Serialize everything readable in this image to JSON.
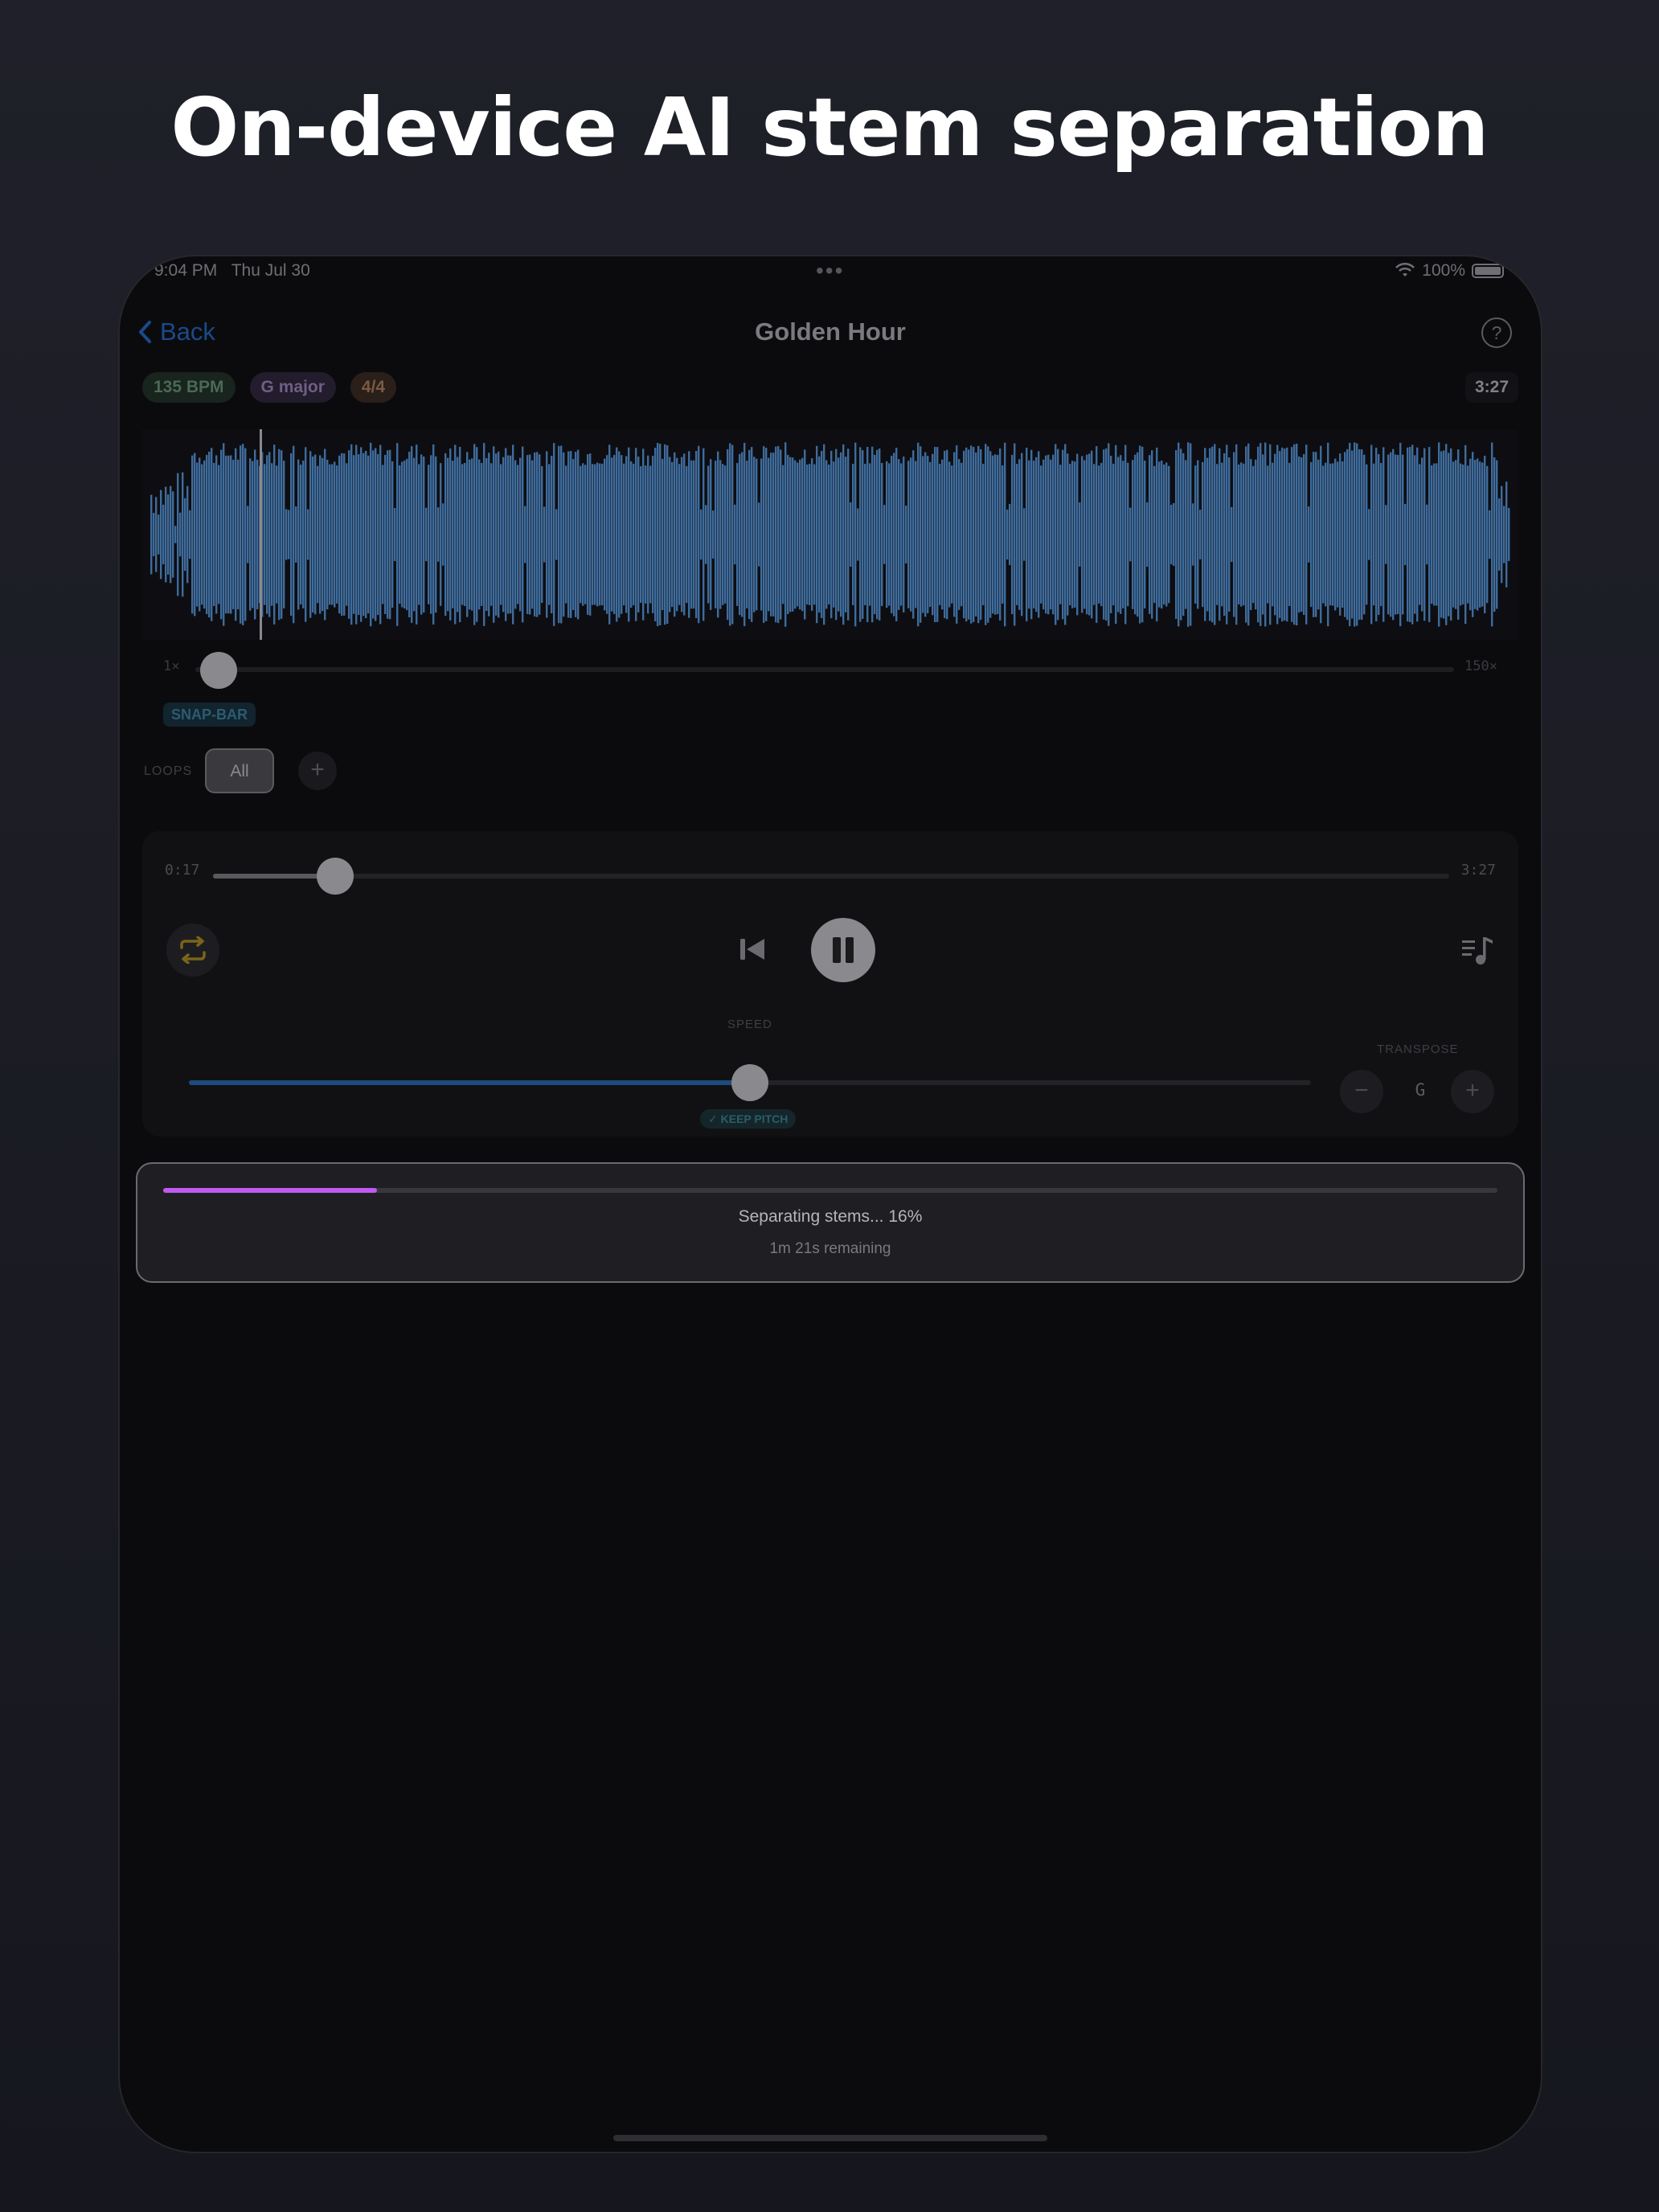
{
  "headline": "On-device AI stem separation",
  "status_bar": {
    "time": "9:04 PM",
    "date": "Thu Jul 30",
    "battery": "100%"
  },
  "nav": {
    "back_label": "Back",
    "title": "Golden Hour",
    "help_icon": "?"
  },
  "track_info": {
    "bpm": "135 BPM",
    "key": "G major",
    "time_signature": "4/4",
    "duration": "3:27"
  },
  "zoom": {
    "min_label": "1×",
    "max_label": "150×"
  },
  "snap_label": "SNAP-BAR",
  "loops": {
    "label": "LOOPS",
    "all_label": "All",
    "add_label": "+"
  },
  "playback": {
    "current_time": "0:17",
    "total_time": "3:27",
    "progress": 0.099,
    "state": "playing"
  },
  "speed": {
    "label": "SPEED",
    "keep_pitch_label": "✓ KEEP PITCH",
    "level": 0.5
  },
  "transpose": {
    "label": "TRANSPOSE",
    "value": "G",
    "minus": "−",
    "plus": "+"
  },
  "stem_progress": {
    "title": "Separating stems... 16%",
    "remaining": "1m 21s remaining",
    "fraction": 0.16
  },
  "colors": {
    "accent_purple": "#bf5af2",
    "waveform_blue": "#3f6c9c",
    "back_blue": "#1a4a8a"
  },
  "icons": [
    "chevron-left-icon",
    "help-icon",
    "wifi-icon",
    "battery-icon",
    "repeat-icon",
    "skip-back-icon",
    "pause-icon",
    "music-queue-icon"
  ]
}
